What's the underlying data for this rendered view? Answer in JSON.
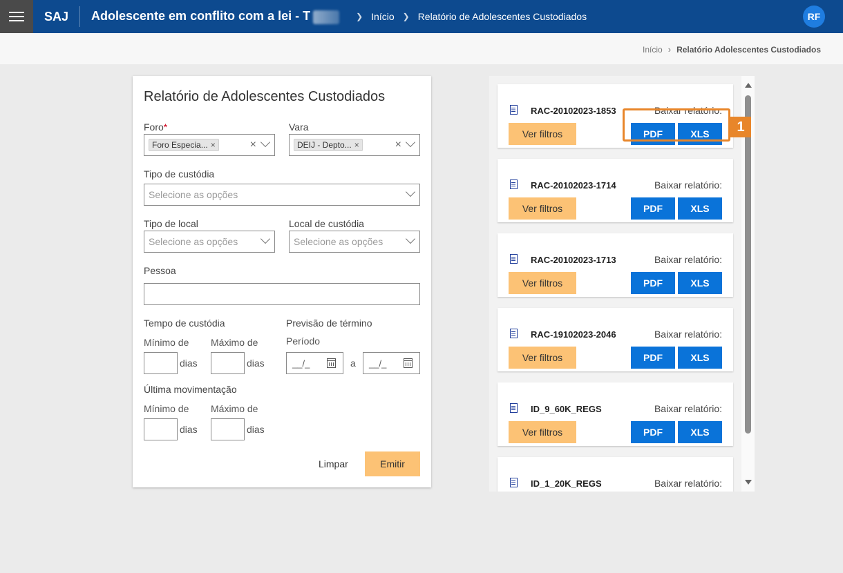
{
  "header": {
    "brand": "SAJ",
    "title": "Adolescente em conflito com a lei - T",
    "crumbs": [
      "Início",
      "Relatório de Adolescentes Custodiados"
    ],
    "avatar": "RF",
    "bg_color": "#0d4a8f"
  },
  "subheader": {
    "crumbs": [
      "Início",
      "Relatório Adolescentes Custodiados"
    ]
  },
  "form": {
    "title": "Relatório de Adolescentes Custodiados",
    "foro": {
      "label": "Foro",
      "required_mark": "*",
      "chip": "Foro Especia..."
    },
    "vara": {
      "label": "Vara",
      "chip": "DEIJ - Depto..."
    },
    "tipo_custodia": {
      "label": "Tipo de custódia",
      "placeholder": "Selecione as opções"
    },
    "tipo_local": {
      "label": "Tipo de local",
      "placeholder": "Selecione as opções"
    },
    "local_custodia": {
      "label": "Local de custódia",
      "placeholder": "Selecione as opções"
    },
    "pessoa": {
      "label": "Pessoa",
      "value": ""
    },
    "tempo_custodia": {
      "label": "Tempo de custódia",
      "min_label": "Mínimo de",
      "max_label": "Máximo de",
      "unit": "dias"
    },
    "previsao": {
      "label": "Previsão de término",
      "periodo_label": "Período",
      "date_mask": "__/_",
      "between": "a"
    },
    "ultima_mov": {
      "label": "Última movimentação",
      "min_label": "Mínimo de",
      "max_label": "Máximo de",
      "unit": "dias"
    },
    "clear_button": "Limpar",
    "emit_button": "Emitir"
  },
  "reports": {
    "download_label": "Baixar relatório:",
    "filters_button": "Ver filtros",
    "pdf_button": "PDF",
    "xls_button": "XLS",
    "items": [
      {
        "name": "RAC-20102023-1853"
      },
      {
        "name": "RAC-20102023-1714"
      },
      {
        "name": "RAC-20102023-1713"
      },
      {
        "name": "RAC-19102023-2046"
      },
      {
        "name": "ID_9_60K_REGS"
      },
      {
        "name": "ID_1_20K_REGS"
      }
    ]
  },
  "callout": {
    "number": "1",
    "color": "#e8862a"
  }
}
